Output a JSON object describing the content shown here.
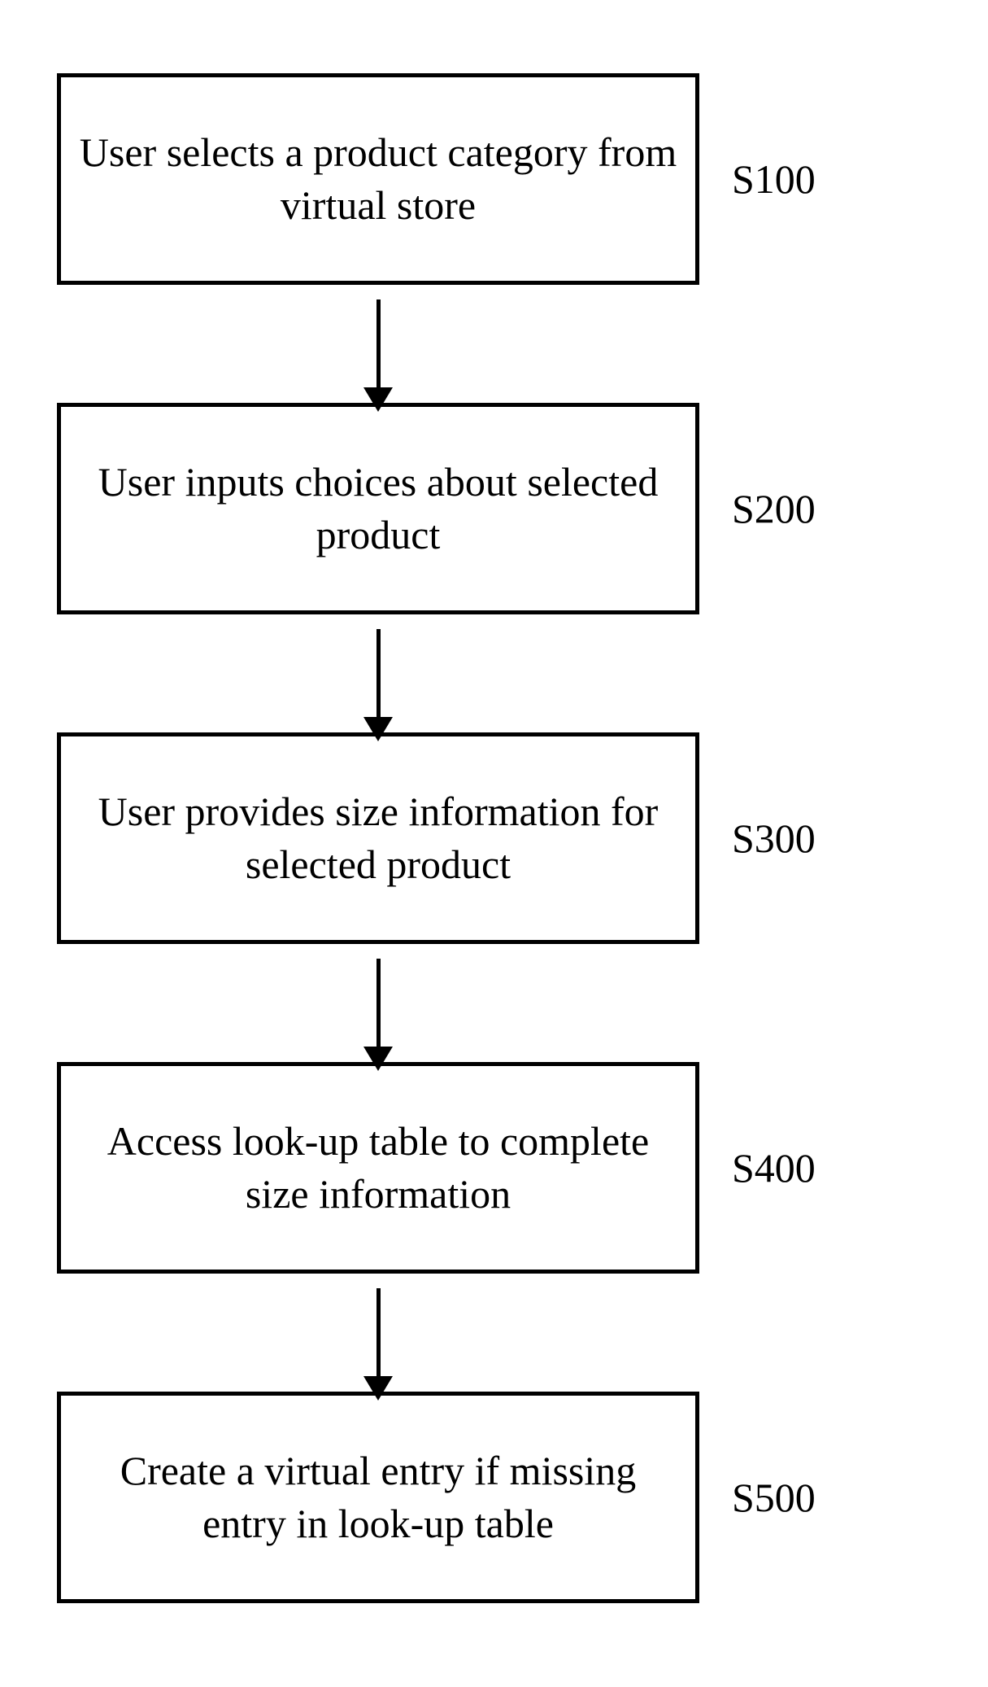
{
  "flowchart": {
    "steps": [
      {
        "text": "User selects a product category from virtual store",
        "label": "S100"
      },
      {
        "text": "User inputs choices about selected product",
        "label": "S200"
      },
      {
        "text": "User provides size information for selected product",
        "label": "S300"
      },
      {
        "text": "Access look-up table to complete size information",
        "label": "S400"
      },
      {
        "text": "Create a virtual entry if missing entry in look-up table",
        "label": "S500"
      }
    ]
  }
}
